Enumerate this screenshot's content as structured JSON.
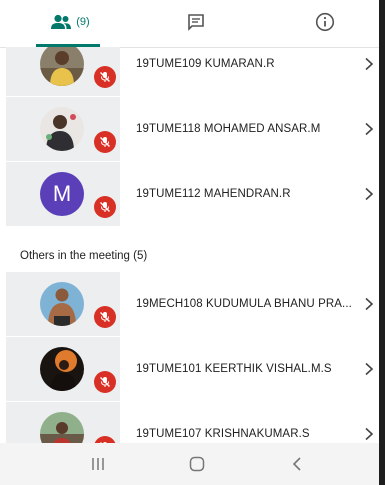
{
  "tabs": {
    "participants": {
      "icon": "people-icon",
      "count": "(9)"
    },
    "chat": {
      "icon": "chat-icon"
    },
    "info": {
      "icon": "info-icon"
    }
  },
  "participants_top": [
    {
      "name": "19TUME109 KUMARAN.R",
      "avatar": "photo"
    },
    {
      "name": "19TUME118 MOHAMED ANSAR.M",
      "avatar": "photo"
    },
    {
      "name": "19TUME112 MAHENDRAN.R",
      "avatar": "letter",
      "initial": "M"
    }
  ],
  "others_section": {
    "label": "Others in the meeting (5)"
  },
  "participants_others": [
    {
      "name": "19MECH108 KUDUMULA BHANU PRA...",
      "avatar": "photo"
    },
    {
      "name": "19TUME101 KEERTHIK VISHAL.M.S",
      "avatar": "photo"
    },
    {
      "name": "19TUME107 KRISHNAKUMAR.S",
      "avatar": "photo"
    }
  ],
  "nav": {
    "recents": "recents-icon",
    "home": "home-icon",
    "back": "back-icon"
  },
  "colors": {
    "accent": "#00796b",
    "mute": "#d93025",
    "avatar_letter_bg": "#5b3fb9"
  }
}
